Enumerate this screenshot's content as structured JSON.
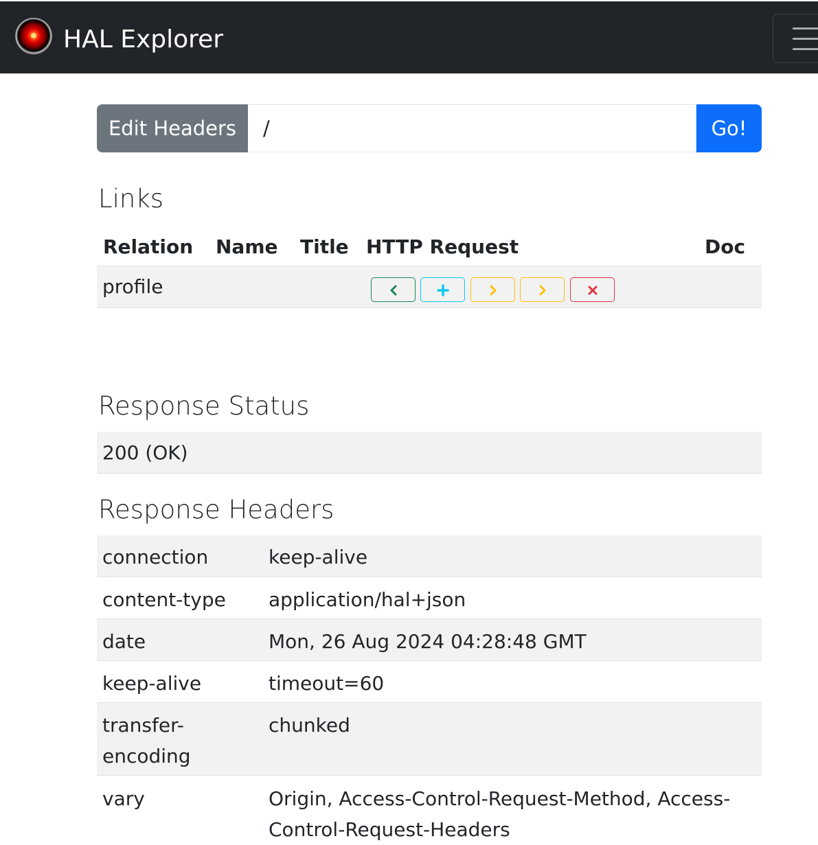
{
  "navbar": {
    "logo_icon": "hal-9000-eye-icon",
    "brand": "HAL Explorer",
    "toggler_icon": "hamburger-menu-icon"
  },
  "request": {
    "edit_headers_label": "Edit Headers",
    "url_value": "/",
    "go_label": "Go!"
  },
  "links": {
    "title": "Links",
    "columns": [
      "Relation",
      "Name",
      "Title",
      "HTTP Request",
      "Doc"
    ],
    "rows": [
      {
        "relation": "profile",
        "name": "",
        "title": "",
        "actions": [
          {
            "method": "GET",
            "icon": "chevron-left-icon",
            "color": "#198754"
          },
          {
            "method": "POST",
            "icon": "plus-icon",
            "color": "#0dcaf0"
          },
          {
            "method": "PUT",
            "icon": "chevron-right-icon",
            "color": "#ffc107"
          },
          {
            "method": "PATCH",
            "icon": "chevron-right-icon",
            "color": "#ffc107"
          },
          {
            "method": "DELETE",
            "icon": "x-icon",
            "color": "#dc3545"
          }
        ]
      }
    ]
  },
  "response_status": {
    "title": "Response Status",
    "value": "200 (OK)"
  },
  "response_headers": {
    "title": "Response Headers",
    "rows": [
      {
        "name": "connection",
        "value": "keep-alive"
      },
      {
        "name": "content-type",
        "value": "application/hal+json"
      },
      {
        "name": "date",
        "value": "Mon, 26 Aug 2024 04:28:48 GMT"
      },
      {
        "name": "keep-alive",
        "value": "timeout=60"
      },
      {
        "name_line1": "transfer-",
        "name_line2": "encoding",
        "value": "chunked"
      },
      {
        "name": "vary",
        "value_line1": "Origin, Access-Control-Request-Method, Access-",
        "value_line2": "Control-Request-Headers"
      }
    ]
  },
  "colors": {
    "navbar_bg": "#212529",
    "secondary": "#6c757d",
    "primary": "#0d6efd",
    "stripe": "#f2f2f2"
  }
}
